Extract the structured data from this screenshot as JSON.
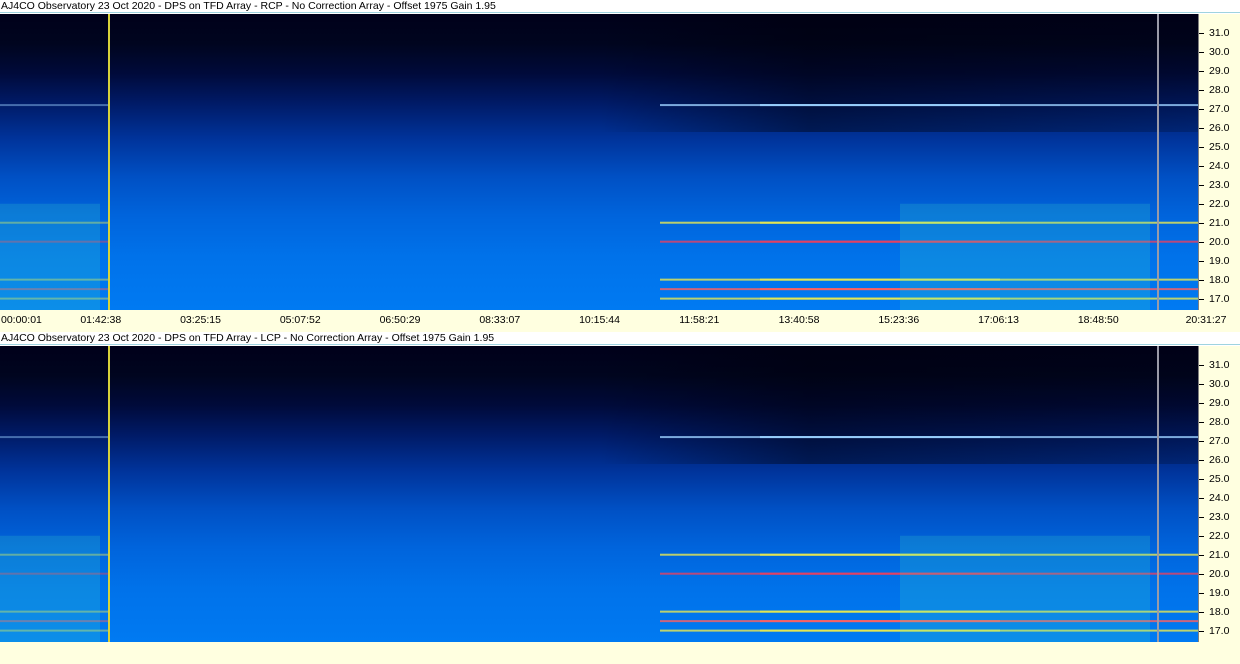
{
  "window": {
    "app_title": "AJ4CO Observatory"
  },
  "chart_data": [
    {
      "type": "heatmap",
      "title": "AJ4CO Observatory 23 Oct 2020 - DPS on TFD Array  - RCP  -  No Correction Array  -  Offset 1975  Gain 1.95",
      "x_tick_labels": [
        "00:00:01",
        "01:42:38",
        "03:25:15",
        "05:07:52",
        "06:50:29",
        "08:33:07",
        "10:15:44",
        "11:58:21",
        "13:40:58",
        "15:23:36",
        "17:06:13",
        "18:48:50",
        "20:31:27"
      ],
      "y_tick_labels": [
        "31.0",
        "30.0",
        "29.0",
        "28.0",
        "27.0",
        "26.0",
        "25.0",
        "24.0",
        "23.0",
        "22.0",
        "21.0",
        "20.0",
        "19.0",
        "18.0",
        "17.0"
      ],
      "ylim": [
        16.4,
        32.0
      ],
      "markers": {
        "yellow_time": "01:42:38",
        "grey_time": "19:56:00"
      },
      "bands": [
        {
          "freq": 27.2,
          "color": "#9ad0ff"
        },
        {
          "freq": 21.0,
          "color": "#e8e850"
        },
        {
          "freq": 20.0,
          "color": "#e84060"
        },
        {
          "freq": 18.0,
          "color": "#e8e850"
        },
        {
          "freq": 17.5,
          "color": "#ff6060"
        },
        {
          "freq": 17.0,
          "color": "#e8e850"
        }
      ]
    },
    {
      "type": "heatmap",
      "title": "AJ4CO Observatory 23 Oct 2020 - DPS on TFD Array  - LCP  -  No Correction Array  -  Offset 1975  Gain 1.95",
      "x_tick_labels": [],
      "y_tick_labels": [
        "31.0",
        "30.0",
        "29.0",
        "28.0",
        "27.0",
        "26.0",
        "25.0",
        "24.0",
        "23.0",
        "22.0",
        "21.0",
        "20.0",
        "19.0",
        "18.0",
        "17.0"
      ],
      "ylim": [
        16.4,
        32.0
      ],
      "markers": {
        "yellow_time": "01:42:38",
        "grey_time": "19:56:00"
      },
      "bands": [
        {
          "freq": 27.2,
          "color": "#9ad0ff"
        },
        {
          "freq": 21.0,
          "color": "#e8e850"
        },
        {
          "freq": 20.0,
          "color": "#e84060"
        },
        {
          "freq": 18.0,
          "color": "#e8e850"
        },
        {
          "freq": 17.5,
          "color": "#ff6060"
        },
        {
          "freq": 17.0,
          "color": "#e8e850"
        }
      ]
    }
  ]
}
